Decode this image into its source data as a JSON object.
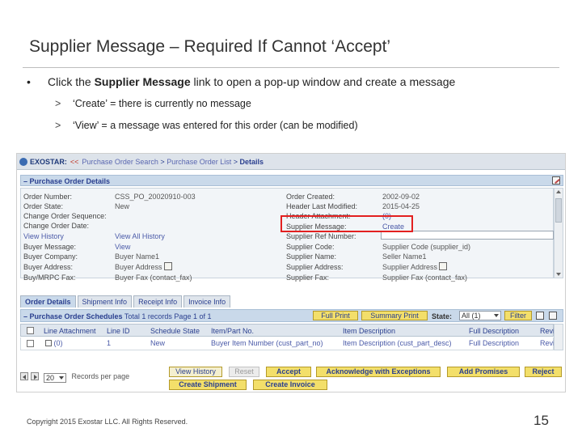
{
  "slide": {
    "title": "Supplier Message – Required If Cannot ‘Accept’",
    "bullet_prefix": "Click the ",
    "bullet_bold": "Supplier Message",
    "bullet_suffix": " link to open a pop-up window and create a message",
    "sub_bullets": [
      "‘Create’ = there is currently no message",
      "‘View’ = a message was entered for this order (can be modified)"
    ],
    "copyright": "Copyright 2015 Exostar LLC. All Rights Reserved.",
    "page_number": "15"
  },
  "app": {
    "breadcrumb": {
      "brand": "EXOSTAR:",
      "back": "<<",
      "items": [
        "Purchase Order Search",
        ">",
        "Purchase Order List",
        ">",
        "Details"
      ]
    },
    "po_details": {
      "header": "– Purchase Order Details",
      "left_fields": [
        {
          "label": "Order Number:",
          "value": "CSS_PO_20020910-003"
        },
        {
          "label": "Order State:",
          "value": "New"
        },
        {
          "label": "Change Order Sequence:",
          "value": ""
        },
        {
          "label": "Change Order Date:",
          "value": ""
        },
        {
          "label": "View History",
          "value": "View All History"
        },
        {
          "label": "Buyer Message:",
          "value": "View"
        },
        {
          "label": "Buyer Company:",
          "value": "Buyer Name1"
        },
        {
          "label": "Buyer Address:",
          "value": "Buyer Address"
        },
        {
          "label": "Buy/MRPC Fax:",
          "value": "Buyer Fax (contact_fax)"
        }
      ],
      "right_fields": [
        {
          "label": "Order Created:",
          "value": "2002-09-02"
        },
        {
          "label": "Header Last Modified:",
          "value": "2015-04-25"
        },
        {
          "label": "Header Attachment:",
          "value": "(0)"
        },
        {
          "label": "Supplier Message:",
          "value": "Create"
        },
        {
          "label": "Supplier Ref Number:",
          "value": ""
        },
        {
          "label": "Supplier Code:",
          "value": "Supplier Code (supplier_id)"
        },
        {
          "label": "Supplier Name:",
          "value": "Seller Name1"
        },
        {
          "label": "Supplier Address:",
          "value": "Supplier Address"
        },
        {
          "label": "Supplier Fax:",
          "value": "Supplier Fax (contact_fax)"
        }
      ]
    },
    "tabs": [
      "Order Details",
      "Shipment Info",
      "Receipt Info",
      "Invoice Info"
    ],
    "schedules": {
      "header_bold": "– Purchase Order Schedules",
      "header_info": "Total 1 records Page 1 of 1",
      "full_print": "Full Print",
      "summary_print": "Summary Print",
      "state_label": "State:",
      "state_value": "All (1)",
      "filter": "Filter",
      "columns": [
        "Line Attachment",
        "Line ID",
        "Schedule State",
        "Item/Part No.",
        "Item Description",
        "Full Description",
        "Revi"
      ],
      "row": [
        "(0)",
        "1",
        "New",
        "Buyer Item Number (cust_part_no)",
        "Item Description (cust_part_desc)",
        "Full Description",
        "Revi"
      ]
    },
    "pager": {
      "per_page": "20",
      "label": "Records per page"
    },
    "buttons": {
      "view_history": "View History",
      "reset": "Reset",
      "accept": "Accept",
      "ack_exceptions": "Acknowledge with Exceptions",
      "add_promises": "Add Promises",
      "reject": "Reject",
      "create_shipment": "Create Shipment",
      "create_invoice": "Create Invoice"
    }
  },
  "colors": {
    "highlight": "#e32020",
    "button_yellow": "#f3df6a",
    "header_blue": "#c9d9ea",
    "link_blue": "#4a5aa8"
  }
}
